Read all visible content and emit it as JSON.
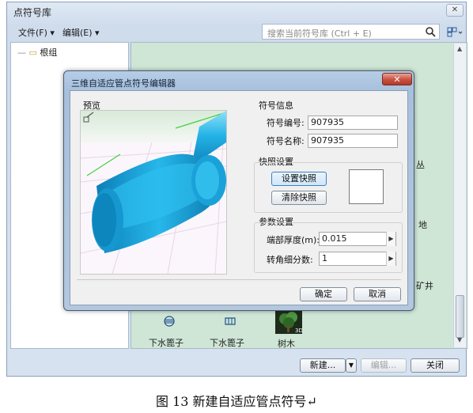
{
  "library": {
    "title": "点符号库",
    "menu_file": "文件(F) ▾",
    "menu_edit": "编辑(E) ▾",
    "search_placeholder": "搜索当前符号库 (Ctrl + E)",
    "tree_root": "根组",
    "side_labels": [
      "丛",
      "地",
      "矿井"
    ],
    "symbols": [
      {
        "label": "下水篦子",
        "icon": "drain-grate-icon"
      },
      {
        "label": "下水篦子",
        "icon": "drain-grate-icon"
      },
      {
        "label": "树木",
        "icon": "tree-icon"
      }
    ],
    "buttons": {
      "new": "新建...",
      "edit": "编辑...",
      "close": "关闭"
    }
  },
  "dialog": {
    "title": "三维自适应管点符号编辑器",
    "preview_label": "预览",
    "info_group": "符号信息",
    "code_label": "符号编号:",
    "code_value": "907935",
    "name_label": "符号名称:",
    "name_value": "907935",
    "snapshot_group": "快照设置",
    "set_snapshot": "设置快照",
    "clear_snapshot": "清除快照",
    "param_group": "参数设置",
    "thickness_label": "端部厚度(m):",
    "thickness_value": "0.015",
    "segments_label": "转角细分数:",
    "segments_value": "1",
    "ok": "确定",
    "cancel": "取消"
  },
  "caption": "图 13 新建自适应管点符号↵",
  "colors": {
    "pipe": "#1aa3d9",
    "dialog_frame": "#a7c0dc",
    "grid_bg": "#cfe6d6"
  }
}
